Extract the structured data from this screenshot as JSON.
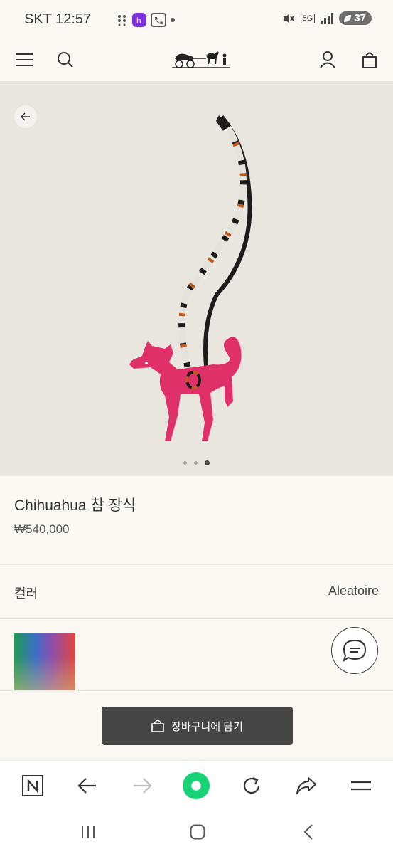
{
  "status_bar": {
    "carrier_time": "SKT 12:57",
    "network": "5G",
    "battery": "37"
  },
  "header": {
    "menu_icon": "hamburger-menu-icon",
    "search_icon": "search-icon",
    "logo": "hermes-carriage-logo",
    "account_icon": "user-icon",
    "bag_icon": "shopping-bag-icon"
  },
  "gallery": {
    "back_icon": "arrow-left-icon",
    "image_subject": "pink chihuahua leather charm with black and printed cords",
    "dots_total": 3,
    "dots_active_index": 2
  },
  "product": {
    "title": "Chihuahua 참 장식",
    "price": "₩540,000"
  },
  "color": {
    "label": "컬러",
    "value": "Aleatoire"
  },
  "chat": {
    "icon": "chat-bubble-icon"
  },
  "cart": {
    "label": "장바구니에 담기",
    "icon": "shopping-bag-icon"
  },
  "browser_toolbar": {
    "items": [
      "naver-icon",
      "arrow-back-icon",
      "arrow-forward-icon",
      "green-home-icon",
      "refresh-icon",
      "share-icon",
      "menu-icon"
    ]
  },
  "system_nav": {
    "items": [
      "recent-apps-icon",
      "home-icon",
      "back-icon"
    ]
  },
  "colors": {
    "background": "#fbf8f3",
    "hero_bg": "#e9e6df",
    "cart_button": "#454545",
    "chihuahua_pink": "#e0306a",
    "browser_green": "#18d277"
  }
}
